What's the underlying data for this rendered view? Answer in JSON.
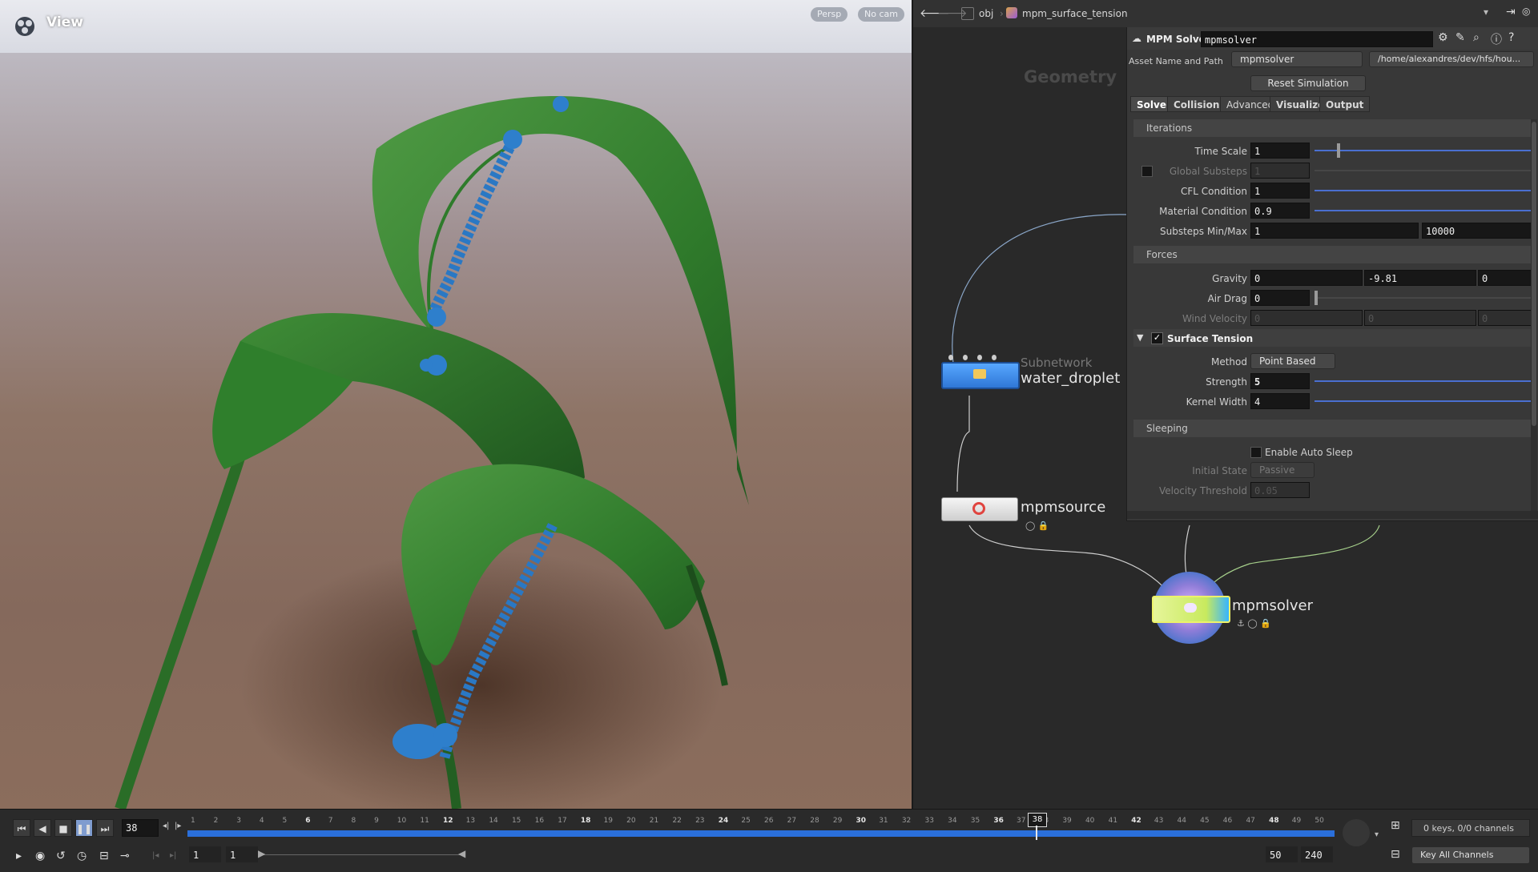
{
  "viewport": {
    "title": "View",
    "persp_label": "Persp",
    "cam_label": "No cam"
  },
  "pathbar": {
    "root": "obj",
    "path": "mpm_surface_tension"
  },
  "network": {
    "context_label": "Geometry",
    "nodes": {
      "subnet": {
        "type": "Subnetwork",
        "name": "water_droplet"
      },
      "source": {
        "name": "mpmsource"
      },
      "solver": {
        "name": "mpmsolver"
      }
    }
  },
  "params": {
    "node_type": "MPM Solver",
    "node_name": "mpmsolver",
    "asset_label": "Asset Name and Path",
    "asset_name": "mpmsolver",
    "asset_path": "/home/alexandres/dev/hfs/hou...",
    "reset_button": "Reset Simulation",
    "tabs": [
      "Solver",
      "Collision",
      "Advanced",
      "Visualize",
      "Output"
    ],
    "iterations": {
      "title": "Iterations",
      "time_scale": {
        "label": "Time Scale",
        "value": "1"
      },
      "global_substeps": {
        "label": "Global Substeps",
        "value": "1"
      },
      "cfl": {
        "label": "CFL Condition",
        "value": "1"
      },
      "material": {
        "label": "Material Condition",
        "value": "0.9"
      },
      "substeps_minmax": {
        "label": "Substeps Min/Max",
        "min": "1",
        "max": "10000"
      }
    },
    "forces": {
      "title": "Forces",
      "gravity": {
        "label": "Gravity",
        "x": "0",
        "y": "-9.81",
        "z": "0"
      },
      "air_drag": {
        "label": "Air Drag",
        "value": "0"
      },
      "wind_velocity": {
        "label": "Wind Velocity",
        "x": "0",
        "y": "0",
        "z": "0"
      }
    },
    "surface_tension": {
      "title": "Surface Tension",
      "method": {
        "label": "Method",
        "value": "Point Based"
      },
      "strength": {
        "label": "Strength",
        "value": "5"
      },
      "kernel_width": {
        "label": "Kernel Width",
        "value": "4"
      }
    },
    "sleeping": {
      "title": "Sleeping",
      "enable_auto_sleep": "Enable Auto Sleep",
      "initial_state": {
        "label": "Initial State",
        "value": "Passive"
      },
      "velocity_threshold": {
        "label": "Velocity Threshold",
        "value": "0.05"
      }
    }
  },
  "timeline": {
    "current_frame": "38",
    "start_frame": "1",
    "end_frame_field": "1",
    "range_end": "50",
    "global_end": "240",
    "keys_label": "0 keys, 0/0 channels",
    "key_all": "Key All Channels",
    "ticks": [
      "1",
      "2",
      "3",
      "4",
      "5",
      "6",
      "7",
      "8",
      "9",
      "10",
      "11",
      "12",
      "13",
      "14",
      "15",
      "16",
      "17",
      "18",
      "19",
      "20",
      "21",
      "22",
      "23",
      "24",
      "25",
      "26",
      "27",
      "28",
      "29",
      "30",
      "31",
      "32",
      "33",
      "34",
      "35",
      "36",
      "37",
      "38",
      "39",
      "40",
      "41",
      "42",
      "43",
      "44",
      "45",
      "46",
      "47",
      "48",
      "49",
      "50"
    ],
    "accent_color": "#2a6fdb"
  }
}
